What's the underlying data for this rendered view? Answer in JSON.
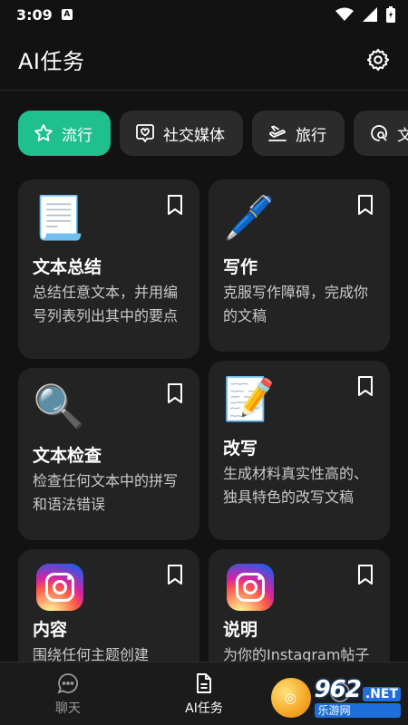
{
  "status": {
    "time": "3:09",
    "app_icon": "A"
  },
  "header": {
    "title": "AI任务"
  },
  "chips": [
    {
      "label": "流行",
      "icon": "star-icon",
      "active": true
    },
    {
      "label": "社交媒体",
      "icon": "heart-bubble-icon",
      "active": false
    },
    {
      "label": "旅行",
      "icon": "plane-icon",
      "active": false
    },
    {
      "label": "文",
      "icon": "search-bubble-icon",
      "active": false
    }
  ],
  "cards": [
    {
      "title": "文本总结",
      "desc": "总结任意文本，并用编号列表列出其中的要点",
      "emoji": "📃"
    },
    {
      "title": "写作",
      "desc": "克服写作障碍，完成你的文稿",
      "emoji": "🖊️"
    },
    {
      "title": "文本检查",
      "desc": "检查任何文本中的拼写和语法错误",
      "emoji": "🔍"
    },
    {
      "title": "改写",
      "desc": "生成材料真实性高的、独具特色的改写文稿",
      "emoji": "📝"
    },
    {
      "title": "内容",
      "desc": "围绕任何主题创建",
      "emoji": "instagram-icon"
    },
    {
      "title": "说明",
      "desc": "为你的Instagram帖子",
      "emoji": "instagram-icon"
    }
  ],
  "nav": [
    {
      "label": "聊天",
      "icon": "chat-icon",
      "active": false
    },
    {
      "label": "AI任务",
      "icon": "document-icon",
      "active": true
    },
    {
      "label": "",
      "icon": "more-icon",
      "active": false
    }
  ],
  "watermark": {
    "number": "962",
    "net": ".NET",
    "sub": "乐游网"
  },
  "colors": {
    "accent": "#20c08e",
    "background": "#121212",
    "card": "#232323"
  }
}
